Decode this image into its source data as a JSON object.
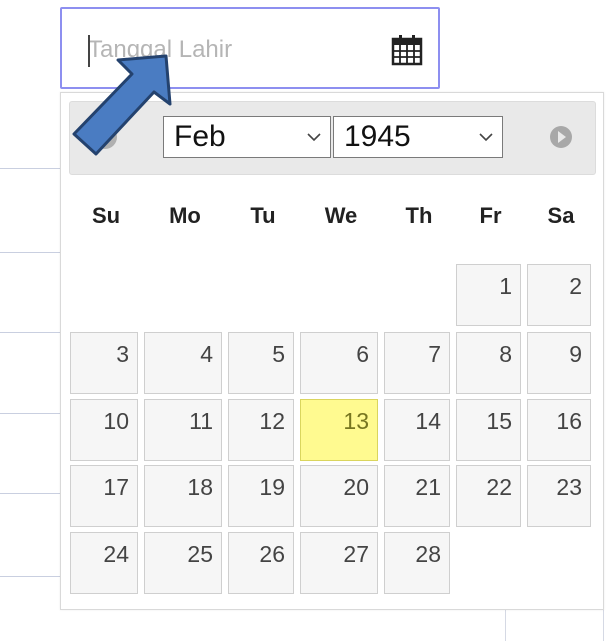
{
  "input": {
    "placeholder": "Tanggal Lahir"
  },
  "picker": {
    "month": "Feb",
    "year": "1945",
    "weekdays": [
      "Su",
      "Mo",
      "Tu",
      "We",
      "Th",
      "Fr",
      "Sa"
    ],
    "days": [
      "1",
      "2",
      "3",
      "4",
      "5",
      "6",
      "7",
      "8",
      "9",
      "10",
      "11",
      "12",
      "13",
      "14",
      "15",
      "16",
      "17",
      "18",
      "19",
      "20",
      "21",
      "22",
      "23",
      "24",
      "25",
      "26",
      "27",
      "28"
    ],
    "highlighted_day": "13",
    "first_weekday_index": 5
  },
  "colors": {
    "input_border": "#8d8ff0",
    "highlight": "#fffa90",
    "arrow": "#4a7cc2"
  },
  "icons": {
    "input": "calendar-icon",
    "prev": "prev-icon",
    "next": "next-icon",
    "annotation": "arrow-pointer"
  }
}
